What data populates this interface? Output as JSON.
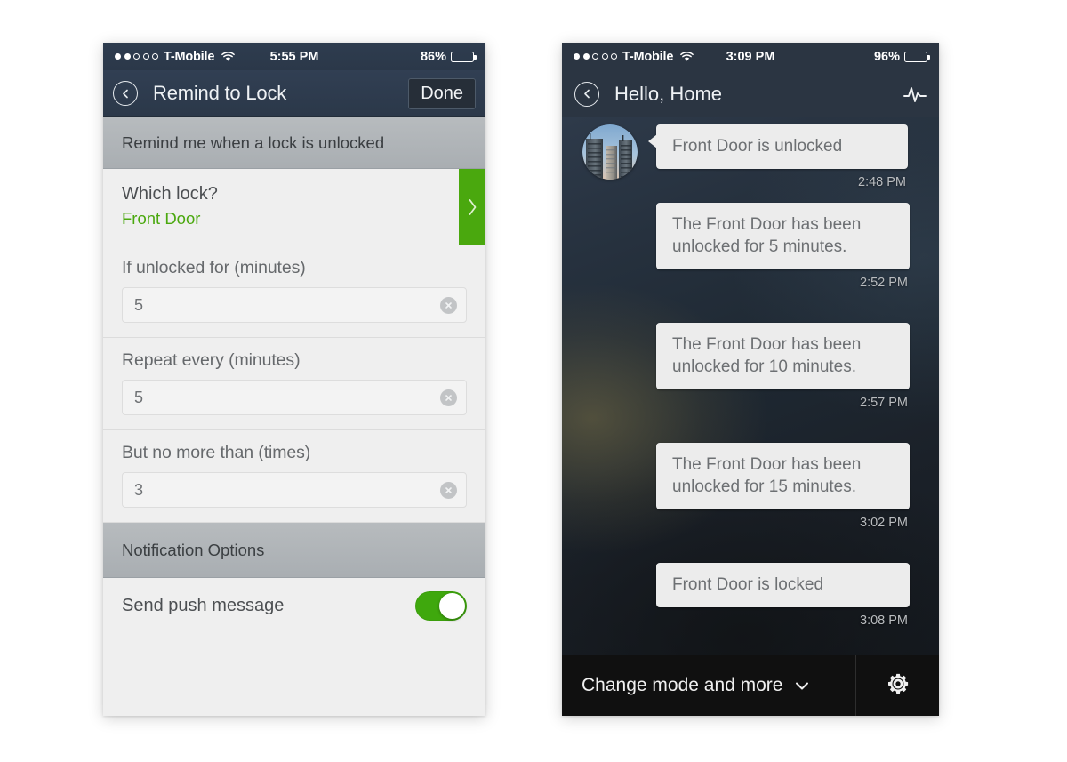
{
  "left_phone": {
    "status_bar": {
      "signal_filled": 2,
      "signal_total": 5,
      "carrier": "T-Mobile",
      "wifi_icon": "wifi-icon",
      "time": "5:55 PM",
      "battery_pct": "86%",
      "battery_level": 86
    },
    "navbar": {
      "back_icon": "back-chevron-circle-icon",
      "title": "Remind to Lock",
      "done_label": "Done"
    },
    "section_header": "Remind me when a lock is unlocked",
    "lock_row": {
      "question": "Which lock?",
      "value": "Front Door",
      "chevron_icon": "chevron-right-icon",
      "accent": "#4aa80e"
    },
    "fields": [
      {
        "label": "If unlocked for (minutes)",
        "value": "5",
        "clear_icon": "clear-circle-icon"
      },
      {
        "label": "Repeat every (minutes)",
        "value": "5",
        "clear_icon": "clear-circle-icon"
      },
      {
        "label": "But no more than (times)",
        "value": "3",
        "clear_icon": "clear-circle-icon"
      }
    ],
    "notification_header": "Notification Options",
    "push_row": {
      "label": "Send push message",
      "toggle_on": true,
      "toggle_color": "#3fa80d"
    }
  },
  "right_phone": {
    "status_bar": {
      "signal_filled": 2,
      "signal_total": 5,
      "carrier": "T-Mobile",
      "wifi_icon": "wifi-icon",
      "time": "3:09 PM",
      "battery_pct": "96%",
      "battery_level": 96
    },
    "navbar": {
      "back_icon": "back-chevron-circle-icon",
      "title": "Hello, Home",
      "activity_icon": "pulse-activity-icon"
    },
    "messages": [
      {
        "text": "Front Door is unlocked",
        "time": "2:48 PM",
        "has_avatar": true
      },
      {
        "text": "The Front Door has been unlocked for 5 minutes.",
        "time": "2:52 PM",
        "has_avatar": false
      },
      {
        "text": "The Front Door has been unlocked for 10 minutes.",
        "time": "2:57 PM",
        "has_avatar": false
      },
      {
        "text": "The Front Door has been unlocked for 15 minutes.",
        "time": "3:02 PM",
        "has_avatar": false
      },
      {
        "text": "Front Door is locked",
        "time": "3:08 PM",
        "has_avatar": false
      }
    ],
    "bottom_bar": {
      "mode_label": "Change mode and more",
      "chevron_icon": "chevron-down-icon",
      "gear_icon": "gear-icon"
    }
  }
}
